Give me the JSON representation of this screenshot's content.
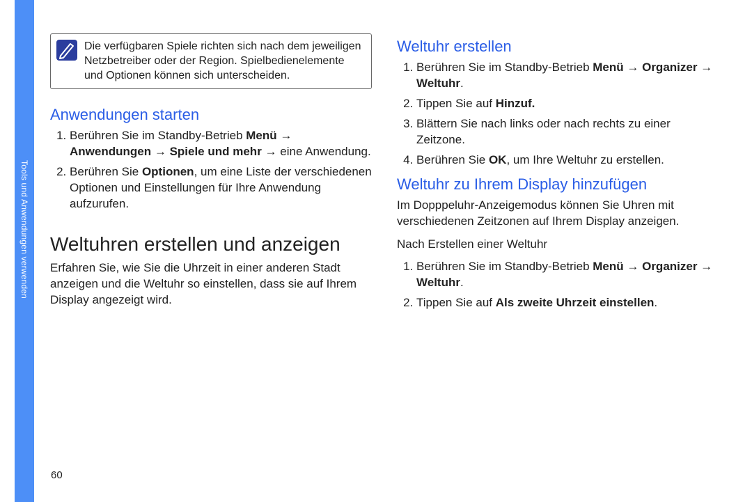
{
  "sidebar_label": "Tools und Anwendungen verwenden",
  "page_number": "60",
  "note": {
    "text": "Die verfügbaren Spiele richten sich nach dem jeweiligen Netzbetreiber oder der Region. Spielbedienelemente und Optionen können sich unterscheiden."
  },
  "left": {
    "sec1_title": "Anwendungen starten",
    "sec1_item1_pre": "Berühren Sie im Standby-Betrieb ",
    "sec1_item1_b1": "Menü",
    "sec1_item1_mid1": " → ",
    "sec1_item1_b2": "Anwendungen",
    "sec1_item1_mid2": " → ",
    "sec1_item1_b3": "Spiele und mehr",
    "sec1_item1_post": " → eine Anwendung.",
    "sec1_item2_pre": "Berühren Sie ",
    "sec1_item2_b": "Optionen",
    "sec1_item2_post": ", um eine Liste der verschiedenen Optionen und Einstellungen für Ihre Anwendung aufzurufen.",
    "sec2_title": "Weltuhren erstellen und anzeigen",
    "sec2_intro": "Erfahren Sie, wie Sie die Uhrzeit in einer anderen Stadt anzeigen und die Weltuhr so einstellen, dass sie auf Ihrem Display angezeigt wird."
  },
  "right": {
    "sec3_title": "Weltuhr erstellen",
    "sec3_item1_pre": "Berühren Sie im Standby-Betrieb ",
    "sec3_item1_b1": "Menü",
    "sec3_item1_mid1": " → ",
    "sec3_item1_b2": "Organizer",
    "sec3_item1_mid2": " → ",
    "sec3_item1_b3": "Weltuhr",
    "sec3_item1_post": ".",
    "sec3_item2_pre": "Tippen Sie auf ",
    "sec3_item2_b": "Hinzuf.",
    "sec3_item3": "Blättern Sie nach links oder nach rechts zu einer Zeitzone.",
    "sec3_item4_pre": "Berühren Sie ",
    "sec3_item4_b": "OK",
    "sec3_item4_post": ", um Ihre Weltuhr zu erstellen.",
    "sec4_title": "Weltuhr zu Ihrem Display hinzufügen",
    "sec4_intro": "Im Dopppeluhr-Anzeigemodus können Sie Uhren mit verschiedenen Zeitzonen auf Ihrem Display anzeigen.",
    "sec4_after": "Nach Erstellen einer Weltuhr",
    "sec4_item1_pre": "Berühren Sie im Standby-Betrieb ",
    "sec4_item1_b1": "Menü",
    "sec4_item1_mid1": " → ",
    "sec4_item1_b2": "Organizer",
    "sec4_item1_mid2": " → ",
    "sec4_item1_b3": "Weltuhr",
    "sec4_item1_post": ".",
    "sec4_item2_pre": "Tippen Sie auf ",
    "sec4_item2_b": "Als zweite Uhrzeit einstellen",
    "sec4_item2_post": "."
  }
}
